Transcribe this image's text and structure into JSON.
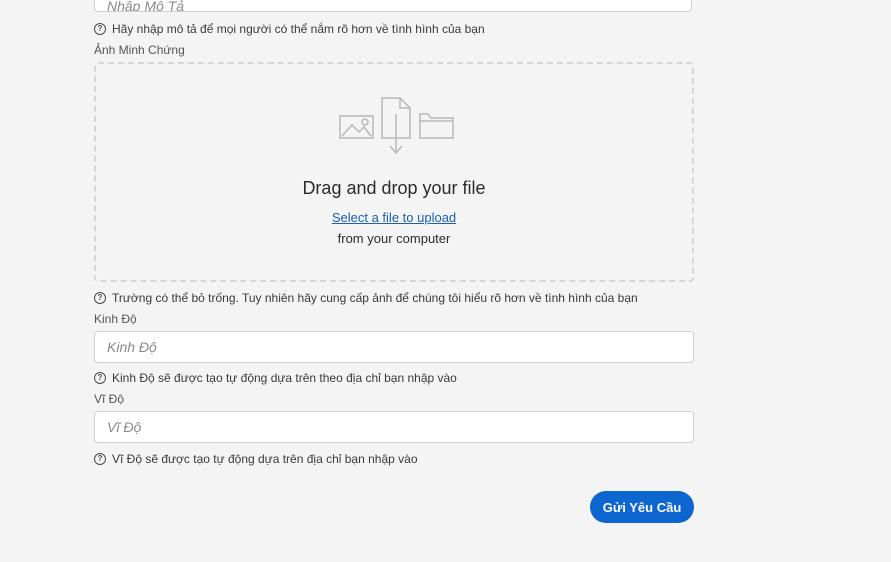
{
  "form": {
    "description": {
      "placeholder": "Nhập Mô Tả",
      "help": "Hãy nhập mô tả để mọi người có thể nắm rõ hơn về tình hình của bạn"
    },
    "evidence": {
      "label": "Ảnh Minh Chứng",
      "dropzone": {
        "title": "Drag and drop your file",
        "link": "Select a file to upload",
        "subtitle": "from your computer"
      },
      "help": "Trường có thể bỏ trống. Tuy nhiên hãy cung cấp ảnh để chúng tôi hiểu rõ hơn về tình hình của bạn"
    },
    "longitude": {
      "label": "Kinh Độ",
      "placeholder": "Kinh Độ",
      "help": "Kinh Độ sẽ được tạo tự động dựa trên theo địa chỉ bạn nhập vào"
    },
    "latitude": {
      "label": "Vĩ Độ",
      "placeholder": "Vĩ Độ",
      "help": "Vĩ Độ sẽ được tạo tự động dựa trên địa chỉ bạn nhập vào"
    },
    "submit_label": "Gửi Yêu Cầu"
  },
  "icons": {
    "help": "question-circle-icon",
    "upload": "file-upload-illustration"
  },
  "colors": {
    "accent": "#0d66d0",
    "link": "#1a5fb4",
    "background": "#f4f4f4"
  }
}
